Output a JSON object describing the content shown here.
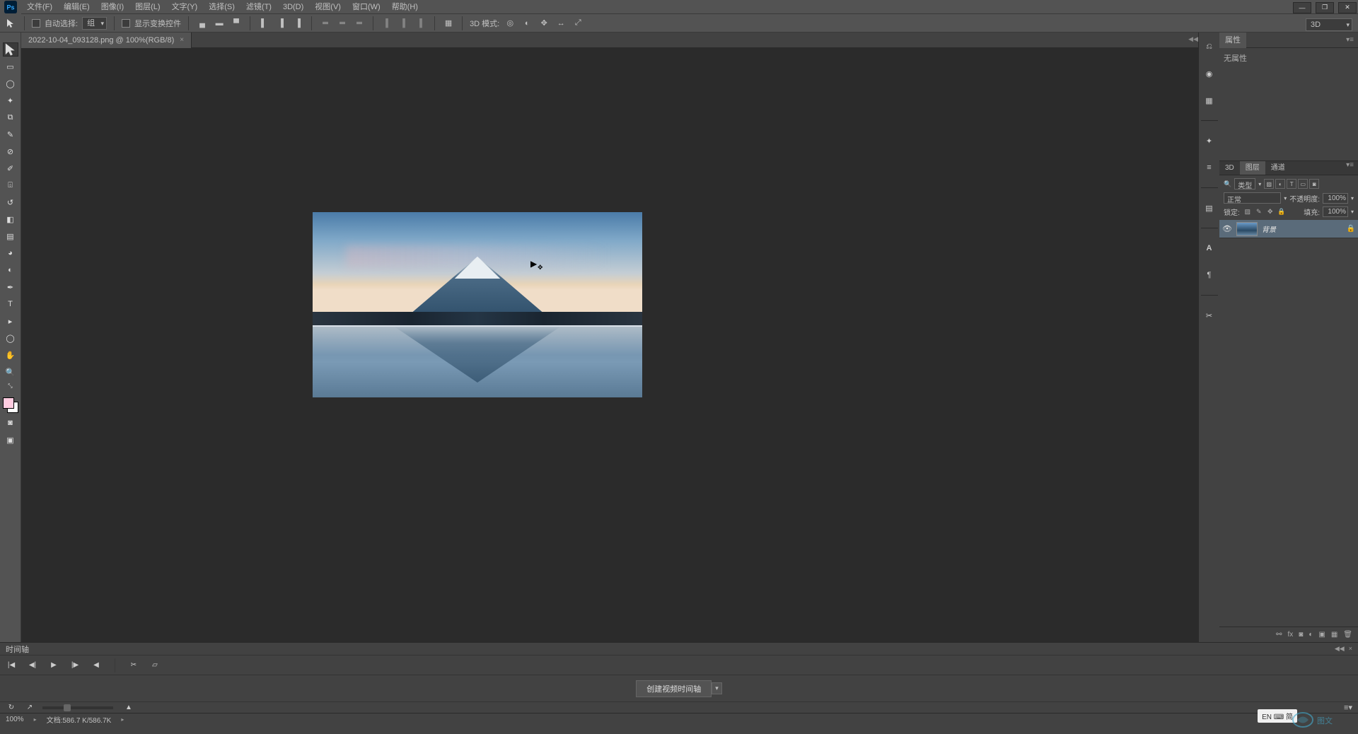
{
  "app": {
    "logo_text": "Ps"
  },
  "menu": {
    "file": "文件(F)",
    "edit": "编辑(E)",
    "image": "图像(I)",
    "layer": "图层(L)",
    "type": "文字(Y)",
    "select": "选择(S)",
    "filter": "滤镜(T)",
    "threeD": "3D(D)",
    "view": "视图(V)",
    "window": "窗口(W)",
    "help": "帮助(H)"
  },
  "options": {
    "auto_select_label": "自动选择:",
    "auto_select_value": "组",
    "show_transform_label": "显示变换控件",
    "threeD_mode_label": "3D 模式:",
    "threeD_right": "3D"
  },
  "documents": {
    "tabs": [
      {
        "title": "2022-10-04_093128.png @ 100%(RGB/8)"
      }
    ]
  },
  "properties": {
    "tab_title": "属性",
    "no_props": "无属性"
  },
  "layers_panel": {
    "tabs": {
      "threeD": "3D",
      "layers": "图层",
      "channels": "通道"
    },
    "kind_label": "类型",
    "blend_mode": "正常",
    "opacity_label": "不透明度:",
    "opacity_value": "100%",
    "lock_label": "锁定:",
    "fill_label": "填充:",
    "fill_value": "100%",
    "layers": [
      {
        "name": "背景"
      }
    ]
  },
  "timeline": {
    "title": "时间轴",
    "create_btn": "创建视频时间轴"
  },
  "status": {
    "zoom": "100%",
    "doc_size": "文档:586.7 K/586.7K"
  },
  "ime": {
    "text": "EN ⌨ 简"
  }
}
